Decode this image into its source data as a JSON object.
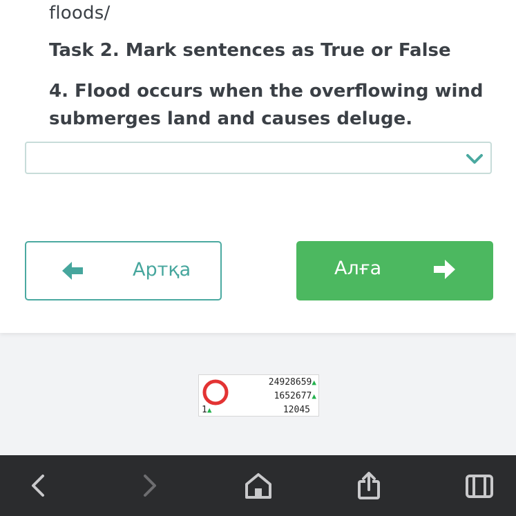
{
  "content": {
    "prev_text": "floods/",
    "task_title": "Task 2. Mark sentences as True or False",
    "question": "4. Flood occurs when the overflowing wind submerges land and causes deluge."
  },
  "answer_select": {
    "value": ""
  },
  "nav": {
    "back_label": "Артқа",
    "next_label": "Алға"
  },
  "counter": {
    "line1": "24928659",
    "line2": "1652677",
    "line3": "12045",
    "small": "1"
  },
  "colors": {
    "teal": "#46a69d",
    "green": "#4cb860",
    "text": "#3b4046",
    "toolbar": "#2b2c2e"
  },
  "browser_toolbar": {
    "icons": [
      "back-arrow-icon",
      "forward-arrow-icon",
      "home-icon",
      "share-icon",
      "tabs-icon"
    ]
  }
}
